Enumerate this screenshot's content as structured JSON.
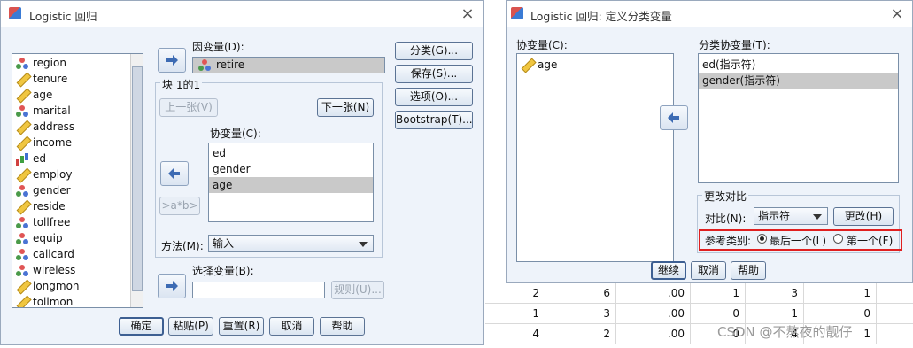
{
  "dlg1": {
    "title": "Logistic 回归",
    "close": "×",
    "variables": [
      {
        "name": "region",
        "icon": "nominal"
      },
      {
        "name": "tenure",
        "icon": "ruler"
      },
      {
        "name": "age",
        "icon": "ruler"
      },
      {
        "name": "marital",
        "icon": "nominal"
      },
      {
        "name": "address",
        "icon": "ruler"
      },
      {
        "name": "income",
        "icon": "ruler"
      },
      {
        "name": "ed",
        "icon": "ordinal"
      },
      {
        "name": "employ",
        "icon": "ruler"
      },
      {
        "name": "gender",
        "icon": "nominal"
      },
      {
        "name": "reside",
        "icon": "ruler"
      },
      {
        "name": "tollfree",
        "icon": "nominal"
      },
      {
        "name": "equip",
        "icon": "nominal"
      },
      {
        "name": "callcard",
        "icon": "nominal"
      },
      {
        "name": "wireless",
        "icon": "nominal"
      },
      {
        "name": "longmon",
        "icon": "ruler"
      },
      {
        "name": "tollmon",
        "icon": "ruler"
      }
    ],
    "dependent_label": "因变量(D):",
    "dependent_value": "retire",
    "block_label": "块 1的1",
    "prev_button": "上一张(V)",
    "next_button": "下一张(N)",
    "covariates_label": "协变量(C):",
    "covariates": [
      "ed",
      "gender",
      "age"
    ],
    "interaction_button": ">a*b>",
    "method_label": "方法(M):",
    "method_value": "输入",
    "selection_label": "选择变量(B):",
    "rule_button": "规则(U)...",
    "side_buttons": [
      "分类(G)...",
      "保存(S)...",
      "选项(O)...",
      "Bootstrap(T)..."
    ],
    "bottom_buttons": [
      "确定",
      "粘贴(P)",
      "重置(R)",
      "取消",
      "帮助"
    ]
  },
  "dlg2": {
    "title": "Logistic 回归: 定义分类变量",
    "close": "×",
    "covariates_label": "协变量(C):",
    "covariates": [
      "age"
    ],
    "categorical_label": "分类协变量(T):",
    "categorical": [
      "ed(指示符)",
      "gender(指示符)"
    ],
    "change_contrast_group": "更改对比",
    "contrast_label": "对比(N):",
    "contrast_value": "指示符",
    "change_button": "更改(H)",
    "reference_label": "参考类别:",
    "ref_last": "最后一个(L)",
    "ref_first": "第一个(F)",
    "bottom_buttons": [
      "继续",
      "取消",
      "帮助"
    ]
  },
  "grid_rows": [
    [
      "2",
      "6",
      ".00",
      "1",
      "3",
      "1"
    ],
    [
      "1",
      "3",
      ".00",
      "0",
      "1",
      "0"
    ],
    [
      "4",
      "2",
      ".00",
      "0",
      "4",
      "1"
    ]
  ],
  "watermark": "CSDN @不熬夜的靓仔"
}
